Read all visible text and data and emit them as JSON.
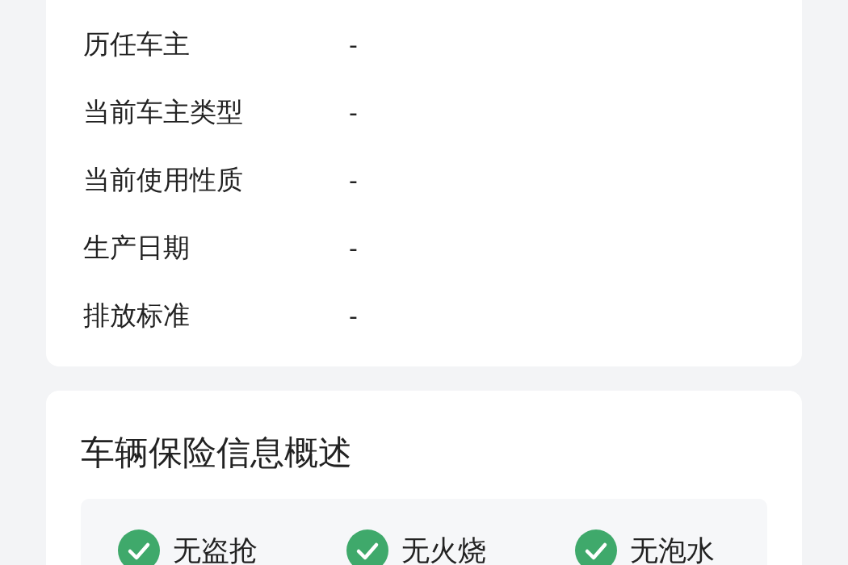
{
  "vehicle_info": {
    "rows": [
      {
        "label": "历任车主",
        "value": "-"
      },
      {
        "label": "当前车主类型",
        "value": "-"
      },
      {
        "label": "当前使用性质",
        "value": "-"
      },
      {
        "label": "生产日期",
        "value": "-"
      },
      {
        "label": "排放标准",
        "value": "-"
      }
    ]
  },
  "insurance_summary": {
    "title": "车辆保险信息概述",
    "items": [
      {
        "label": "无盗抢"
      },
      {
        "label": "无火烧"
      },
      {
        "label": "无泡水"
      }
    ]
  }
}
